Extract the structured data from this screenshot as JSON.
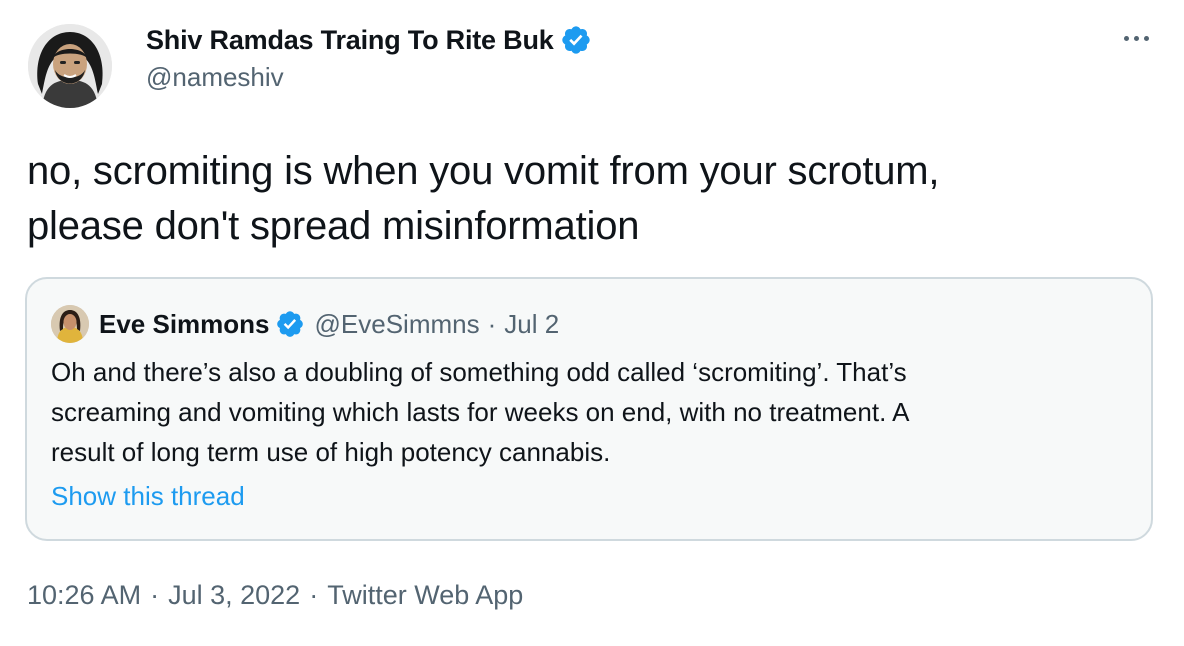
{
  "author": {
    "name": "Shiv Ramdas Traing To Rite Buk",
    "handle": "@nameshiv",
    "verified": true
  },
  "tweet": {
    "text_line1": "no, scromiting is when you vomit from your scrotum,",
    "text_line2": "please don't spread misinformation"
  },
  "quoted": {
    "name": "Eve Simmons",
    "handle": "@EveSimmns",
    "separator": "·",
    "date": "Jul 2",
    "verified": true,
    "text_line1": "Oh and there’s also a doubling of something odd called ‘scromiting’. That’s",
    "text_line2": "screaming and vomiting which lasts for weeks on end, with no treatment. A",
    "text_line3": "result of long term use of high potency cannabis.",
    "link_label": "Show this thread"
  },
  "meta": {
    "time": "10:26 AM",
    "separator": "·",
    "date": "Jul 3, 2022",
    "source": "Twitter Web App"
  },
  "icons": {
    "verified": "verified-badge-icon",
    "more": "more-dots-icon"
  },
  "colors": {
    "primary_text": "#0f1419",
    "secondary_text": "#536471",
    "link": "#1d9bf0",
    "verified": "#1d9bf0",
    "quote_border": "#cfd9de",
    "quote_bg": "#f7f9f9"
  }
}
